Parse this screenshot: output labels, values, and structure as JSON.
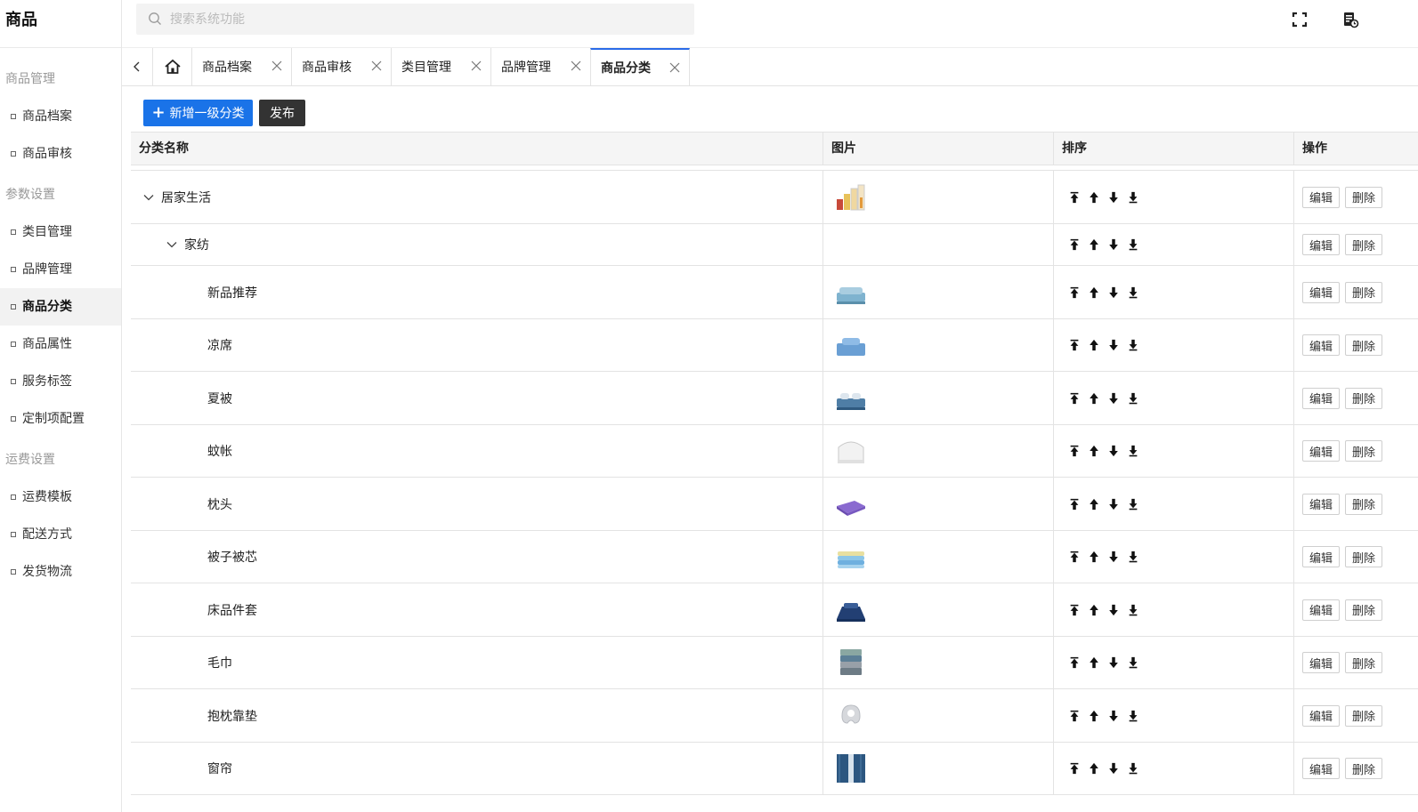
{
  "brand": "商品",
  "sidebar": {
    "groups": [
      {
        "title": "商品管理",
        "items": [
          {
            "label": "商品档案"
          },
          {
            "label": "商品审核"
          }
        ]
      },
      {
        "title": "参数设置",
        "items": [
          {
            "label": "类目管理"
          },
          {
            "label": "品牌管理"
          },
          {
            "label": "商品分类",
            "active": true
          },
          {
            "label": "商品属性"
          },
          {
            "label": "服务标签"
          },
          {
            "label": "定制项配置"
          }
        ]
      },
      {
        "title": "运费设置",
        "items": [
          {
            "label": "运费模板"
          },
          {
            "label": "配送方式"
          },
          {
            "label": "发货物流"
          }
        ]
      }
    ]
  },
  "header": {
    "search_placeholder": "搜索系统功能",
    "icons": [
      "fullscreen-icon",
      "report-icon"
    ]
  },
  "tabs": [
    {
      "label": "商品档案"
    },
    {
      "label": "商品审核"
    },
    {
      "label": "类目管理"
    },
    {
      "label": "品牌管理"
    },
    {
      "label": "商品分类",
      "active": true
    }
  ],
  "toolbar": {
    "add_label": "新增一级分类",
    "publish_label": "发布"
  },
  "table": {
    "columns": [
      "分类名称",
      "图片",
      "排序",
      "操作"
    ],
    "rows": [
      {
        "name": "居家生活",
        "level": 1,
        "expanded": true,
        "image": "kitchen-jars"
      },
      {
        "name": "家纺",
        "level": 2,
        "expanded": true,
        "image": ""
      },
      {
        "name": "新品推荐",
        "level": 3,
        "image": "bed-lightblue"
      },
      {
        "name": "凉席",
        "level": 3,
        "image": "bed-blue"
      },
      {
        "name": "夏被",
        "level": 3,
        "image": "bed-dark"
      },
      {
        "name": "蚊帐",
        "level": 3,
        "image": "mosquito-net"
      },
      {
        "name": "枕头",
        "level": 3,
        "image": "pillow-purple"
      },
      {
        "name": "被子被芯",
        "level": 3,
        "image": "quilt-stack"
      },
      {
        "name": "床品件套",
        "level": 3,
        "image": "bedding-navy"
      },
      {
        "name": "毛巾",
        "level": 3,
        "image": "towels"
      },
      {
        "name": "抱枕靠垫",
        "level": 3,
        "image": "neck-pillow"
      },
      {
        "name": "窗帘",
        "level": 3,
        "image": "curtain"
      }
    ],
    "actions": {
      "edit": "编辑",
      "delete": "删除"
    },
    "sort_icons": [
      "move-top-icon",
      "move-up-icon",
      "move-down-icon",
      "move-bottom-icon"
    ]
  }
}
